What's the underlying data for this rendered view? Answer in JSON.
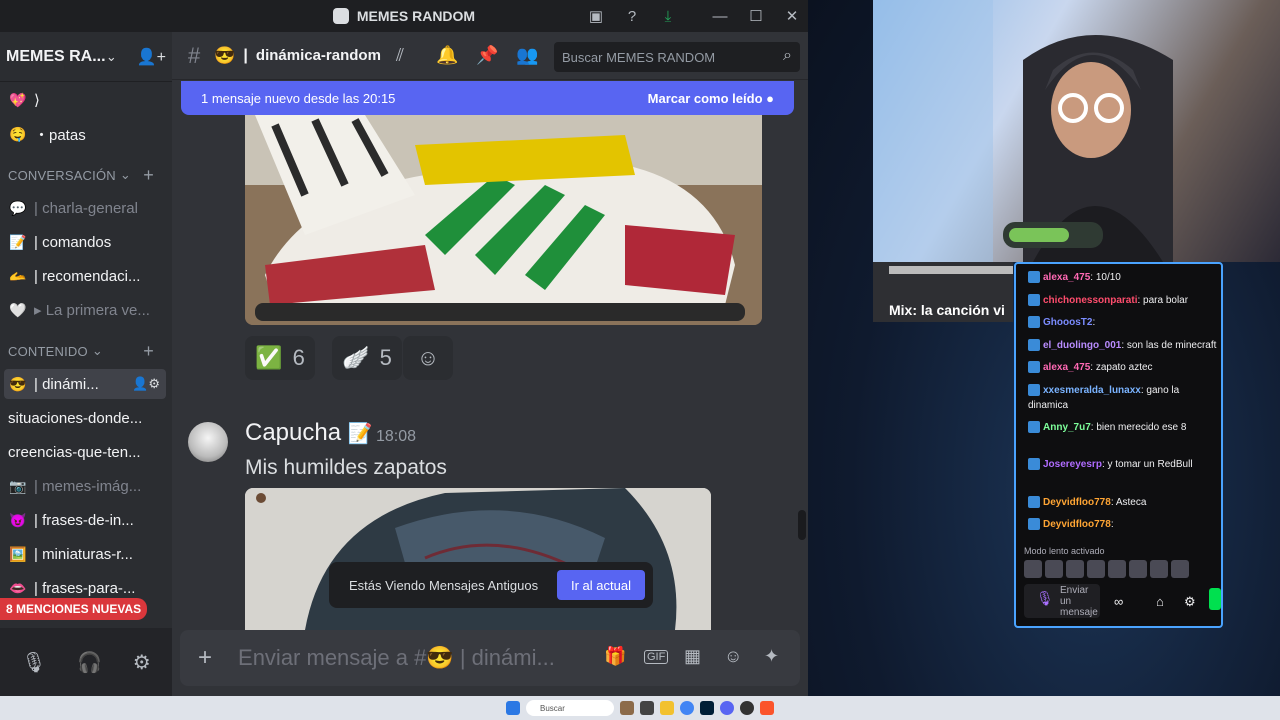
{
  "window": {
    "title": "MEMES RANDOM"
  },
  "server": {
    "name": "MEMES RA..."
  },
  "channels": [
    {
      "emoji": "💖",
      "label": "⟩",
      "muted": false
    },
    {
      "emoji": "🤤",
      "label": "・patas",
      "muted": false
    },
    {
      "emoji": "💬",
      "label": "| charla-general",
      "muted": true
    },
    {
      "emoji": "📝",
      "label": "| comandos",
      "muted": false
    },
    {
      "emoji": "🫴",
      "label": "| recomendaci...",
      "muted": false
    },
    {
      "emoji": "🤍",
      "label": "▸ La primera ve...",
      "muted": true
    },
    {
      "emoji": "😎",
      "label": "| dinámi...",
      "muted": false
    },
    {
      "emoji": "",
      "label": "situaciones-donde...",
      "muted": false
    },
    {
      "emoji": "",
      "label": "creencias-que-ten...",
      "muted": false
    },
    {
      "emoji": "📷",
      "label": "| memes-imág...",
      "muted": true
    },
    {
      "emoji": "😈",
      "label": "| frases-de-in...",
      "muted": false
    },
    {
      "emoji": "🖼️",
      "label": "| miniaturas-r...",
      "muted": false
    },
    {
      "emoji": "👄",
      "label": "| frases-para-...",
      "muted": false
    }
  ],
  "categories": {
    "conversacion": "CONVERSACIÓN",
    "contenido": "CONTENIDO"
  },
  "mentions_badge": "8 MENCIONES NUEVAS",
  "channel": {
    "name": "dinámica-random",
    "emoji": "😎"
  },
  "search": {
    "placeholder": "Buscar MEMES RANDOM"
  },
  "banner": {
    "text": "1 mensaje nuevo desde las 20:15",
    "action": "Marcar como leído"
  },
  "reactions": [
    {
      "emoji": "✅",
      "count": "6"
    },
    {
      "emoji": "🪽",
      "count": "5"
    }
  ],
  "message": {
    "author": "Capucha",
    "time": "18:08",
    "text": "Mis humildes zapatos"
  },
  "old_messages": {
    "text": "Estás Viendo Mensajes Antiguos",
    "jump": "Ir al actual"
  },
  "composer": {
    "placeholder": "Enviar mensaje a #😎 | dinámi..."
  },
  "stream": {
    "card_title": "Mix: la canción vi"
  },
  "chat": [
    {
      "user": "alexa_475",
      "text": "10/10",
      "color": "#ff69b4"
    },
    {
      "user": "chichonessonparati",
      "text": "para bolar",
      "color": "#ff4d6d"
    },
    {
      "user": "GhooosT2",
      "text": "",
      "color": "#7b8cff"
    },
    {
      "user": "el_duolingo_001",
      "text": "son las de minecraft",
      "color": "#b98cff"
    },
    {
      "user": "alexa_475",
      "text": "zapato aztec",
      "color": "#ff69b4"
    },
    {
      "user": "xxesmeralda_lunaxx",
      "text": "gano la dinamica",
      "color": "#7ab3ff"
    },
    {
      "user": "Anny_7u7",
      "text": "bien merecido ese 8",
      "color": "#7dff9b"
    },
    {
      "user": "Josereyesrp",
      "text": "y tomar un RedBull",
      "color": "#b06cff"
    },
    {
      "user": "Deyvidfloo778",
      "text": "Asteca",
      "color": "#ffa534"
    },
    {
      "user": "Deyvidfloo778",
      "text": "",
      "color": "#ffa534"
    }
  ],
  "chat_ui": {
    "slow_mode": "Modo lento activado",
    "input_placeholder": "Enviar un mensaje"
  },
  "taskbar": {
    "search": "Buscar"
  }
}
